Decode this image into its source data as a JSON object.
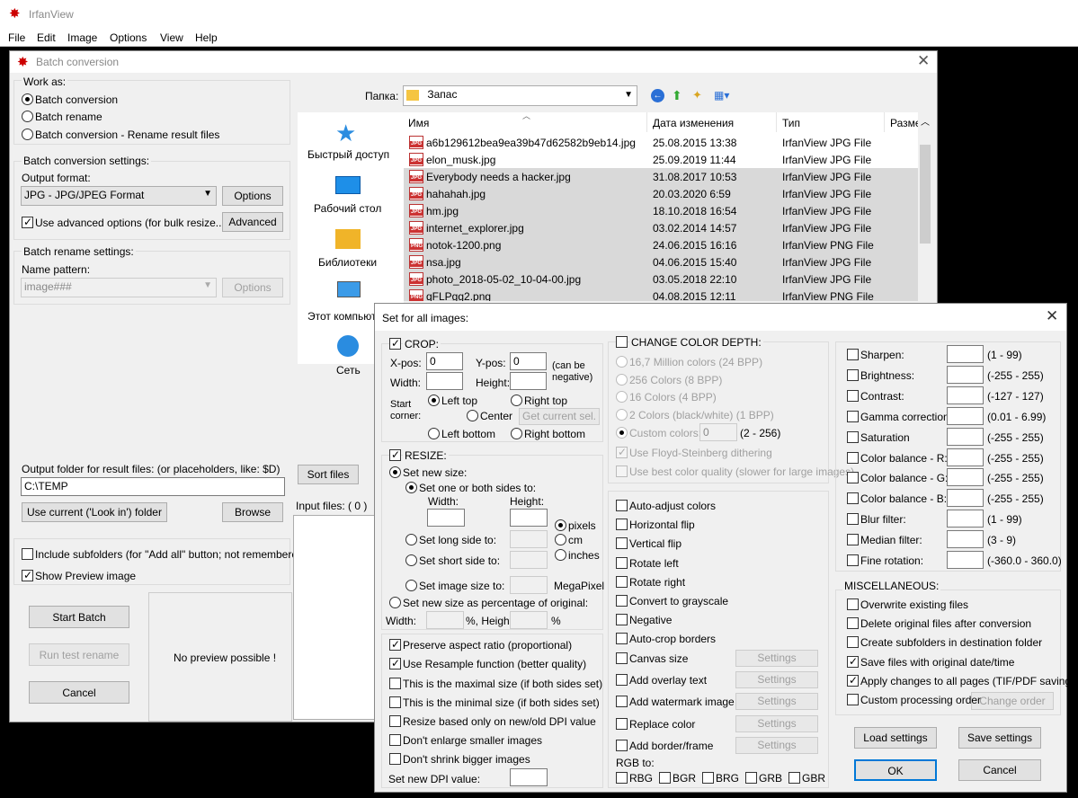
{
  "main": {
    "title": "IrfanView",
    "menu": [
      "File",
      "Edit",
      "Image",
      "Options",
      "View",
      "Help"
    ]
  },
  "batch": {
    "title": "Batch conversion",
    "work_as_label": "Work as:",
    "work_as": [
      "Batch conversion",
      "Batch rename",
      "Batch conversion - Rename result files"
    ],
    "conv_settings_label": "Batch conversion settings:",
    "output_format_label": "Output format:",
    "output_format": "JPG - JPG/JPEG Format",
    "options_btn": "Options",
    "advanced_check": "Use advanced options (for bulk resize...)",
    "advanced_btn": "Advanced",
    "rename_settings_label": "Batch rename settings:",
    "name_pattern_label": "Name pattern:",
    "name_pattern": "image###",
    "rename_options_btn": "Options",
    "output_folder_label": "Output folder for result files: (or placeholders, like: $D)",
    "output_folder": "C:\\TEMP",
    "use_current_btn": "Use current ('Look in') folder",
    "browse_btn": "Browse",
    "include_subfolders": "Include subfolders (for \"Add all\" button; not remembered)",
    "show_preview": "Show Preview image",
    "start_btn": "Start Batch",
    "test_rename_btn": "Run test rename",
    "cancel_btn": "Cancel",
    "no_preview": "No preview possible !",
    "sort_btn": "Sort files",
    "input_files": "Input files: ( 0 )",
    "folder_label": "Папка:",
    "folder": "Запас",
    "places": [
      "Быстрый доступ",
      "Рабочий стол",
      "Библиотеки",
      "Этот компьютер",
      "Сеть"
    ],
    "columns": [
      "Имя",
      "Дата изменения",
      "Тип",
      "Разме"
    ],
    "files": [
      {
        "name": "a6b129612bea9ea39b47d62582b9eb14.jpg",
        "date": "25.08.2015 13:38",
        "type": "IrfanView JPG File",
        "sel": false,
        "ext": "JPG"
      },
      {
        "name": "elon_musk.jpg",
        "date": "25.09.2019 11:44",
        "type": "IrfanView JPG File",
        "sel": false,
        "ext": "JPG"
      },
      {
        "name": "Everybody needs a hacker.jpg",
        "date": "31.08.2017 10:53",
        "type": "IrfanView JPG File",
        "sel": true,
        "ext": "JPG"
      },
      {
        "name": "hahahah.jpg",
        "date": "20.03.2020 6:59",
        "type": "IrfanView JPG File",
        "sel": true,
        "ext": "JPG"
      },
      {
        "name": "hm.jpg",
        "date": "18.10.2018 16:54",
        "type": "IrfanView JPG File",
        "sel": true,
        "ext": "JPG"
      },
      {
        "name": "internet_explorer.jpg",
        "date": "03.02.2014 14:57",
        "type": "IrfanView JPG File",
        "sel": true,
        "ext": "JPG"
      },
      {
        "name": "notok-1200.png",
        "date": "24.06.2015 16:16",
        "type": "IrfanView PNG File",
        "sel": true,
        "ext": "PNG"
      },
      {
        "name": "nsa.jpg",
        "date": "04.06.2015 15:40",
        "type": "IrfanView JPG File",
        "sel": true,
        "ext": "JPG"
      },
      {
        "name": "photo_2018-05-02_10-04-00.jpg",
        "date": "03.05.2018 22:10",
        "type": "IrfanView JPG File",
        "sel": true,
        "ext": "JPG"
      },
      {
        "name": "qFLPgg2.png",
        "date": "04.08.2015 12:11",
        "type": "IrfanView PNG File",
        "sel": true,
        "ext": "PNG"
      }
    ]
  },
  "adv": {
    "title": "Set for all images:",
    "crop": "CROP:",
    "xpos": "X-pos:",
    "xpos_val": "0",
    "ypos": "Y-pos:",
    "ypos_val": "0",
    "can_be_negative": "(can be negative)",
    "width": "Width:",
    "height": "Height:",
    "start_corner": "Start corner:",
    "left_top": "Left top",
    "right_top": "Right top",
    "center": "Center",
    "get_current": "Get current sel.",
    "left_bottom": "Left bottom",
    "right_bottom": "Right bottom",
    "resize": "RESIZE:",
    "set_new_size": "Set new size:",
    "one_or_both": "Set one or both sides to:",
    "w_label": "Width:",
    "h_label": "Height:",
    "pixels": "pixels",
    "cm": "cm",
    "inches": "inches",
    "long_side": "Set long side to:",
    "short_side": "Set short side to:",
    "image_size": "Set image size to:",
    "megapixel": "MegaPixel",
    "percentage": "Set new size as percentage of original:",
    "pct_width": "Width:",
    "pct_height": "%, Height:",
    "pct_sign": "%",
    "preserve": "Preserve aspect ratio (proportional)",
    "resample": "Use Resample function (better quality)",
    "maximal": "This is the maximal size (if both sides set)",
    "minimal": "This is the minimal size (if both sides set)",
    "dpi_based": "Resize based only on new/old DPI value",
    "dont_enlarge": "Don't enlarge smaller images",
    "dont_shrink": "Don't shrink bigger images",
    "set_dpi": "Set new DPI value:",
    "color_depth": "CHANGE COLOR DEPTH:",
    "depths": [
      "16,7 Million colors (24 BPP)",
      "256 Colors (8 BPP)",
      "16 Colors (4 BPP)",
      "2 Colors (black/white) (1 BPP)"
    ],
    "custom_colors": "Custom colors:",
    "custom_val": "0",
    "custom_range": "(2 - 256)",
    "floyd": "Use Floyd-Steinberg dithering",
    "best_quality": "Use best color quality (slower for large images)",
    "ops": [
      "Auto-adjust colors",
      "Horizontal flip",
      "Vertical flip",
      "Rotate left",
      "Rotate right",
      "Convert to grayscale",
      "Negative",
      "Auto-crop borders"
    ],
    "settings_ops": [
      "Canvas size",
      "Add overlay text",
      "Add watermark image",
      "Replace color",
      "Add border/frame"
    ],
    "settings_btn": "Settings",
    "rgb_to": "RGB to:",
    "rgb": [
      "RBG",
      "BGR",
      "BRG",
      "GRB",
      "GBR"
    ],
    "filters": [
      {
        "label": "Sharpen:",
        "range": "(1  -  99)"
      },
      {
        "label": "Brightness:",
        "range": "(-255  -  255)"
      },
      {
        "label": "Contrast:",
        "range": "(-127  -  127)"
      },
      {
        "label": "Gamma correction:",
        "range": "(0.01  -  6.99)"
      },
      {
        "label": "Saturation",
        "range": "(-255  -  255)"
      },
      {
        "label": "Color balance - R:",
        "range": "(-255  -  255)"
      },
      {
        "label": "Color balance - G:",
        "range": "(-255  -  255)"
      },
      {
        "label": "Color balance - B:",
        "range": "(-255  -  255)"
      },
      {
        "label": "Blur filter:",
        "range": "(1  -  99)"
      },
      {
        "label": "Median filter:",
        "range": "(3  -  9)"
      },
      {
        "label": "Fine rotation:",
        "range": "(-360.0  -  360.0)"
      }
    ],
    "misc": "MISCELLANEOUS:",
    "misc_items": [
      "Overwrite existing files",
      "Delete original files after conversion",
      "Create subfolders in destination folder",
      "Save files with original date/time",
      "Apply changes to all pages (TIF/PDF saving)",
      "Custom processing order"
    ],
    "change_order": "Change order",
    "load_btn": "Load settings",
    "save_btn": "Save settings",
    "ok_btn": "OK",
    "cancel_btn": "Cancel"
  }
}
